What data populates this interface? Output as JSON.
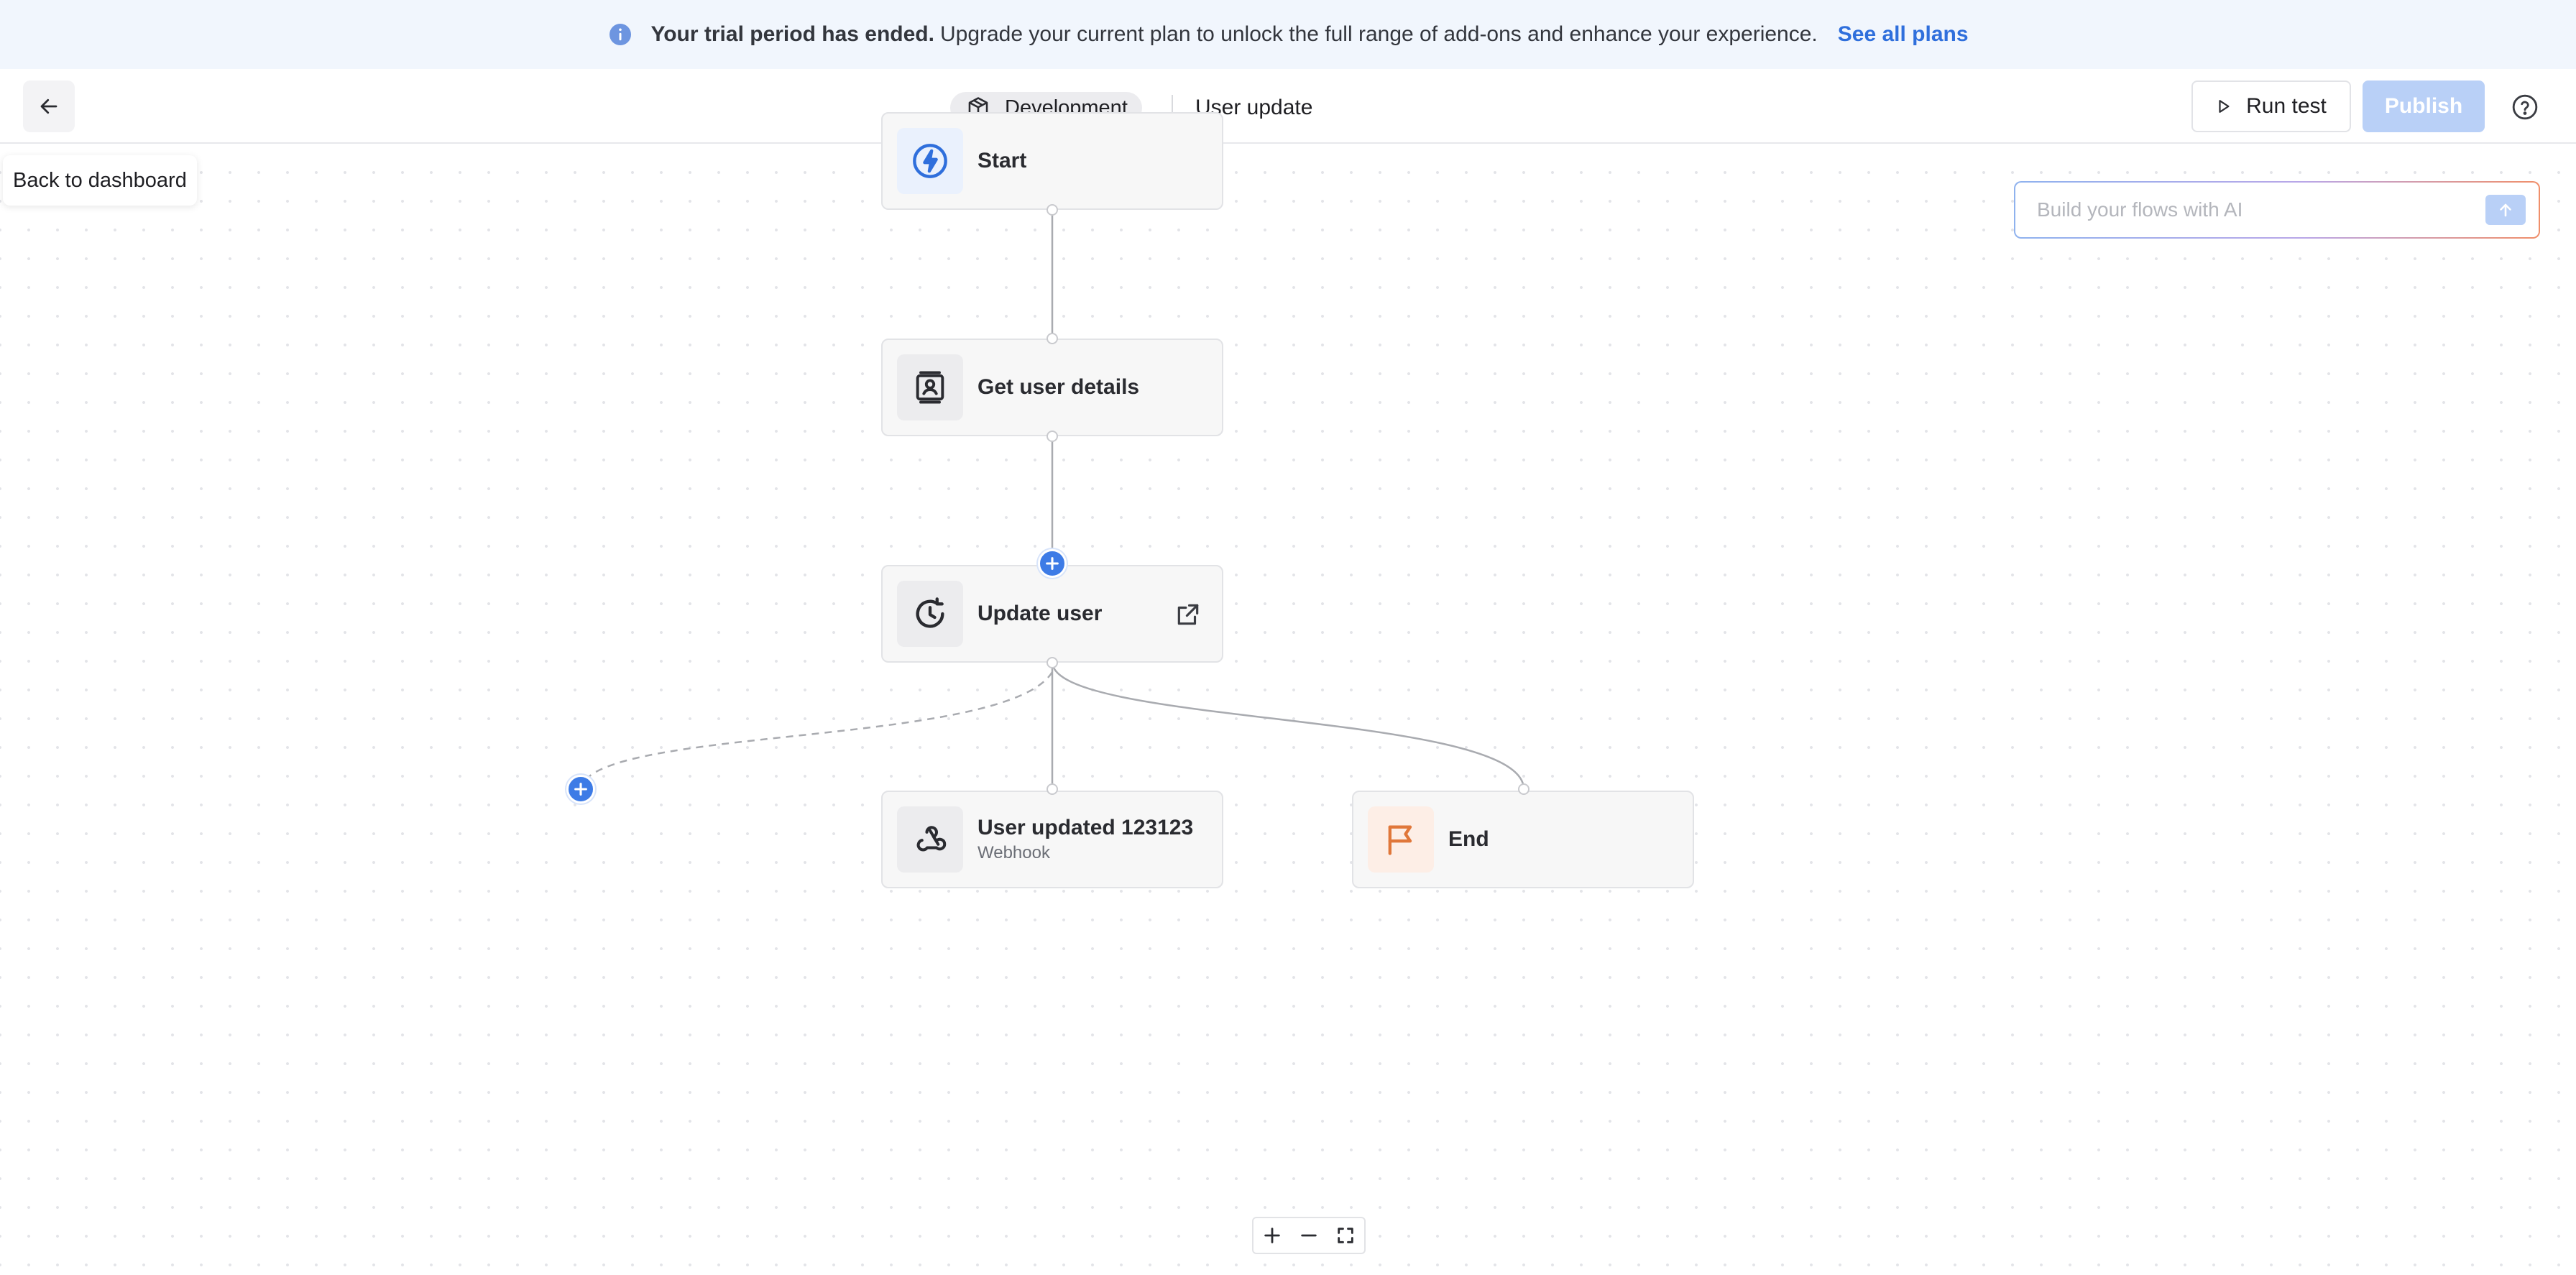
{
  "banner": {
    "strong_text": "Your trial period has ended.",
    "text": "Upgrade your current plan to unlock the full range of add-ons and enhance your experience.",
    "link": "See all plans"
  },
  "header": {
    "back_tooltip": "Back to dashboard",
    "environment": "Development",
    "flow_name": "User update",
    "run_test_label": "Run test",
    "publish_label": "Publish"
  },
  "ai": {
    "placeholder": "Build your flows with AI"
  },
  "nodes": {
    "start": {
      "title": "Start"
    },
    "get_user": {
      "title": "Get user details"
    },
    "update_user": {
      "title": "Update user"
    },
    "webhook": {
      "title": "User updated 123123",
      "subtitle": "Webhook"
    },
    "end": {
      "title": "End"
    }
  },
  "colors": {
    "accent": "#3d7be6",
    "publish_disabled": "#b9d0f7",
    "banner_bg": "#f1f6fd",
    "end_icon": "#e0773a"
  }
}
